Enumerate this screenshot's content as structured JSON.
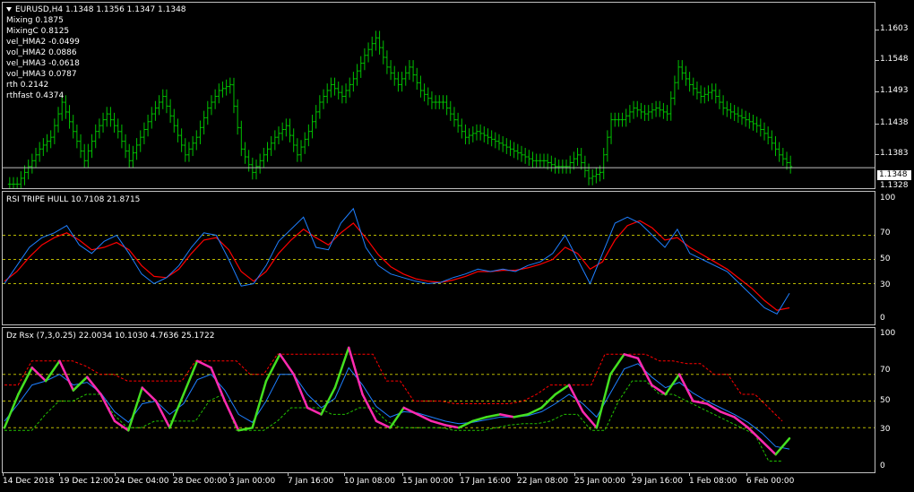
{
  "main": {
    "symbol_info": "EURUSD,H4  1.1348 1.1356 1.1347 1.1348",
    "indicators": [
      "Mixing 0.1875",
      "MixingC 0.8125",
      "vel_HMA2 -0.0499",
      "vol_HMA2 0.0886",
      "vel_HMA3 -0.0618",
      "vol_HMA3 0.0787",
      "rth 0.2142",
      "rthfast 0.4374"
    ],
    "price_ticks": [
      "1.1603",
      "1.1548",
      "1.1493",
      "1.1438",
      "1.1383",
      "1.1328"
    ],
    "current_price": "1.1348",
    "bar_color": "#00c000"
  },
  "rsi": {
    "title": "RSI TRIPE HULL 10.7108 21.8715",
    "ticks": [
      "100",
      "70",
      "50",
      "30",
      "0"
    ],
    "fast_color": "#1e7fff",
    "slow_color": "#ff0000"
  },
  "dz": {
    "title": "Dz Rsx (7,3,0.25) 22.0034 10.1030 4.7636 25.1722",
    "ticks": [
      "100",
      "70",
      "50",
      "30",
      "0"
    ],
    "up_color": "#44e020",
    "down_color": "#ff2ab0",
    "signal_color": "#1e7fff",
    "upper_band_color": "#ff0000",
    "lower_band_color": "#22c000"
  },
  "time_axis": [
    "14 Dec 2018",
    "19 Dec 12:00",
    "24 Dec 04:00",
    "28 Dec 00:00",
    "3 Jan 00:00",
    "7 Jan 16:00",
    "10 Jan 08:00",
    "15 Jan 00:00",
    "17 Jan 16:00",
    "22 Jan 08:00",
    "25 Jan 00:00",
    "29 Jan 16:00",
    "1 Feb 08:00",
    "6 Feb 00:00"
  ],
  "chart_data": [
    {
      "type": "line",
      "title": "EURUSD,H4",
      "price_close_approx": [
        1.132,
        1.135,
        1.138,
        1.14,
        1.146,
        1.141,
        1.136,
        1.141,
        1.144,
        1.141,
        1.136,
        1.14,
        1.144,
        1.147,
        1.142,
        1.137,
        1.14,
        1.145,
        1.148,
        1.149,
        1.138,
        1.134,
        1.137,
        1.14,
        1.142,
        1.137,
        1.141,
        1.146,
        1.149,
        1.147,
        1.15,
        1.154,
        1.157,
        1.152,
        1.149,
        1.152,
        1.148,
        1.146,
        1.146,
        1.143,
        1.14,
        1.141,
        1.14,
        1.139,
        1.138,
        1.137,
        1.136,
        1.136,
        1.135,
        1.135,
        1.137,
        1.133,
        1.134,
        1.143,
        1.143,
        1.145,
        1.144,
        1.145,
        1.144,
        1.152,
        1.149,
        1.147,
        1.148,
        1.145,
        1.144,
        1.143,
        1.142,
        1.14,
        1.137,
        1.135
      ],
      "ylim": [
        1.131,
        1.163
      ]
    },
    {
      "type": "line",
      "title": "RSI TRIPE HULL",
      "series": [
        {
          "name": "10.7108",
          "values": [
            30,
            45,
            60,
            68,
            72,
            78,
            62,
            55,
            65,
            70,
            55,
            38,
            30,
            35,
            45,
            60,
            72,
            70,
            50,
            28,
            30,
            45,
            65,
            75,
            85,
            60,
            58,
            80,
            92,
            60,
            45,
            38,
            35,
            32,
            30,
            31,
            35,
            38,
            42,
            40,
            42,
            40,
            45,
            48,
            55,
            70,
            50,
            30,
            55,
            80,
            85,
            80,
            70,
            60,
            75,
            55,
            50,
            45,
            40,
            30,
            20,
            10,
            5,
            22
          ]
        },
        {
          "name": "21.8715",
          "values": [
            32,
            40,
            52,
            62,
            68,
            72,
            66,
            58,
            60,
            64,
            58,
            45,
            36,
            35,
            42,
            55,
            66,
            68,
            58,
            40,
            32,
            40,
            55,
            66,
            75,
            68,
            62,
            72,
            80,
            68,
            54,
            44,
            38,
            34,
            32,
            31,
            33,
            36,
            40,
            40,
            41,
            41,
            43,
            46,
            50,
            60,
            55,
            42,
            48,
            66,
            78,
            82,
            76,
            66,
            68,
            60,
            54,
            48,
            42,
            34,
            26,
            16,
            8,
            10
          ]
        }
      ],
      "ylim": [
        0,
        100
      ]
    },
    {
      "type": "line",
      "title": "Dz Rsx (7,3,0.25)",
      "series": [
        {
          "name": "22.0034",
          "values": [
            30,
            55,
            75,
            65,
            80,
            58,
            68,
            55,
            35,
            28,
            60,
            50,
            30,
            55,
            80,
            75,
            50,
            28,
            30,
            65,
            85,
            70,
            45,
            40,
            60,
            90,
            55,
            35,
            30,
            45,
            40,
            35,
            32,
            30,
            35,
            38,
            40,
            38,
            40,
            45,
            55,
            62,
            42,
            30,
            70,
            85,
            82,
            62,
            55,
            70,
            50,
            48,
            42,
            38,
            30,
            20,
            10,
            22
          ]
        },
        {
          "name": "10.1030",
          "values": [
            35,
            48,
            62,
            65,
            70,
            62,
            64,
            56,
            42,
            34,
            48,
            50,
            40,
            48,
            66,
            70,
            58,
            40,
            34,
            50,
            70,
            70,
            55,
            45,
            52,
            75,
            62,
            46,
            38,
            42,
            41,
            38,
            35,
            33,
            34,
            36,
            38,
            38,
            39,
            42,
            48,
            55,
            48,
            38,
            56,
            74,
            78,
            68,
            60,
            64,
            56,
            50,
            45,
            40,
            34,
            26,
            16,
            14
          ]
        },
        {
          "name": "4.7636",
          "values": [
            62,
            62,
            80,
            80,
            80,
            80,
            76,
            70,
            70,
            65,
            65,
            65,
            65,
            65,
            80,
            80,
            80,
            80,
            70,
            70,
            85,
            85,
            85,
            85,
            85,
            85,
            85,
            85,
            65,
            65,
            50,
            50,
            50,
            48,
            48,
            48,
            48,
            48,
            50,
            55,
            62,
            62,
            62,
            62,
            85,
            85,
            85,
            85,
            80,
            80,
            78,
            78,
            70,
            70,
            55,
            55,
            45,
            35
          ]
        },
        {
          "name": "25.1722",
          "values": [
            28,
            28,
            28,
            40,
            50,
            50,
            55,
            55,
            40,
            30,
            30,
            35,
            35,
            35,
            35,
            50,
            55,
            28,
            28,
            28,
            35,
            45,
            45,
            45,
            40,
            40,
            45,
            45,
            35,
            30,
            30,
            30,
            30,
            28,
            28,
            28,
            30,
            32,
            33,
            33,
            35,
            40,
            40,
            28,
            28,
            50,
            65,
            65,
            55,
            55,
            50,
            45,
            40,
            35,
            30,
            25,
            5,
            5
          ]
        }
      ],
      "ylim": [
        0,
        100
      ]
    }
  ]
}
